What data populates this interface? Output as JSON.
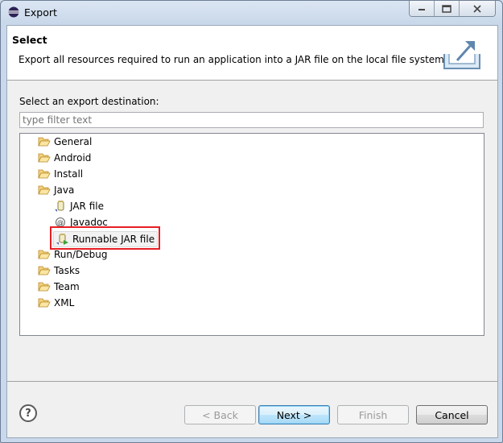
{
  "window": {
    "title": "Export"
  },
  "titlebar_controls": {
    "minimize": "▭",
    "maximize": "□",
    "close": "✕"
  },
  "header": {
    "title": "Select",
    "description": "Export all resources required to run an application into a JAR file on the local file system."
  },
  "body": {
    "label": "Select an export destination:",
    "filter": {
      "placeholder": "type filter text",
      "value": ""
    }
  },
  "tree": {
    "items": [
      {
        "label": "General",
        "icon": "folder-open-icon"
      },
      {
        "label": "Android",
        "icon": "folder-open-icon"
      },
      {
        "label": "Install",
        "icon": "folder-open-icon"
      },
      {
        "label": "Java",
        "icon": "folder-open-icon"
      },
      {
        "label": "JAR file",
        "icon": "jar-icon"
      },
      {
        "label": "Javadoc",
        "icon": "javadoc-icon"
      },
      {
        "label": "Runnable JAR file",
        "icon": "runnable-jar-icon",
        "selected": true
      },
      {
        "label": "Run/Debug",
        "icon": "folder-open-icon"
      },
      {
        "label": "Tasks",
        "icon": "folder-open-icon"
      },
      {
        "label": "Team",
        "icon": "folder-open-icon"
      },
      {
        "label": "XML",
        "icon": "folder-open-icon"
      }
    ]
  },
  "buttons": {
    "help": "?",
    "back": "< Back",
    "next": "Next >",
    "finish": "Finish",
    "cancel": "Cancel"
  },
  "colors": {
    "highlight_box": "#e81e25",
    "default_button": "#3c7fb1"
  }
}
